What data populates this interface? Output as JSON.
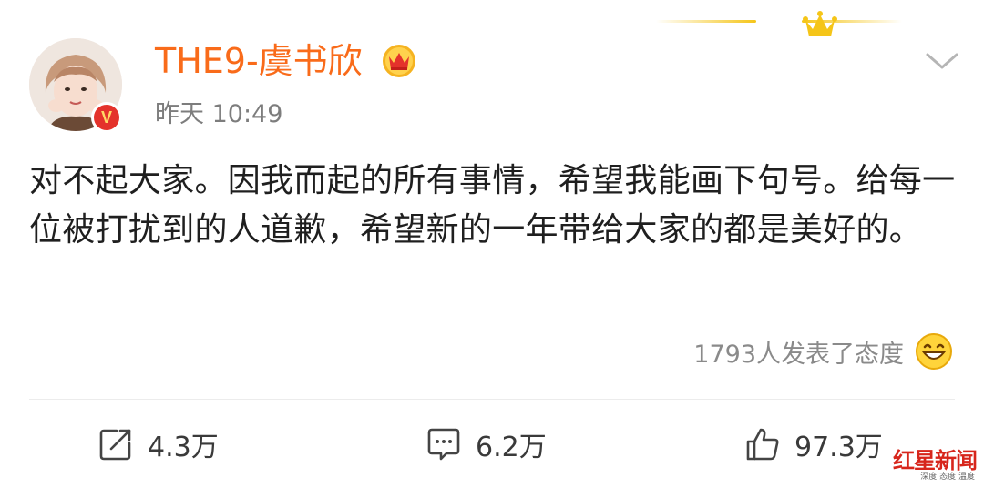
{
  "post": {
    "username": "THE9-虞书欣",
    "timestamp": "昨天 10:49",
    "text": "对不起大家。因我而起的所有事情，希望我能画下句号。给每一位被打扰到的人道歉，希望新的一年带给大家的都是美好的。",
    "reactions_summary": "1793人发表了态度",
    "verified_badge": "V"
  },
  "actions": {
    "repost_count": "4.3万",
    "comment_count": "6.2万",
    "like_count": "97.3万"
  },
  "icons": {
    "header_decoration": "crown-icon",
    "vip": "vip-crown-icon",
    "menu": "chevron-down-icon",
    "reaction": "grinning-emoji-icon",
    "repost": "repost-icon",
    "comment": "comment-icon",
    "like": "thumbs-up-icon"
  },
  "colors": {
    "username": "#f96b1a",
    "crown": "#f5c518",
    "verified_badge": "#e4322b",
    "watermark": "#d7261c"
  },
  "watermark": {
    "logo": "红星新闻",
    "tagline": "深度 态度 温度"
  }
}
